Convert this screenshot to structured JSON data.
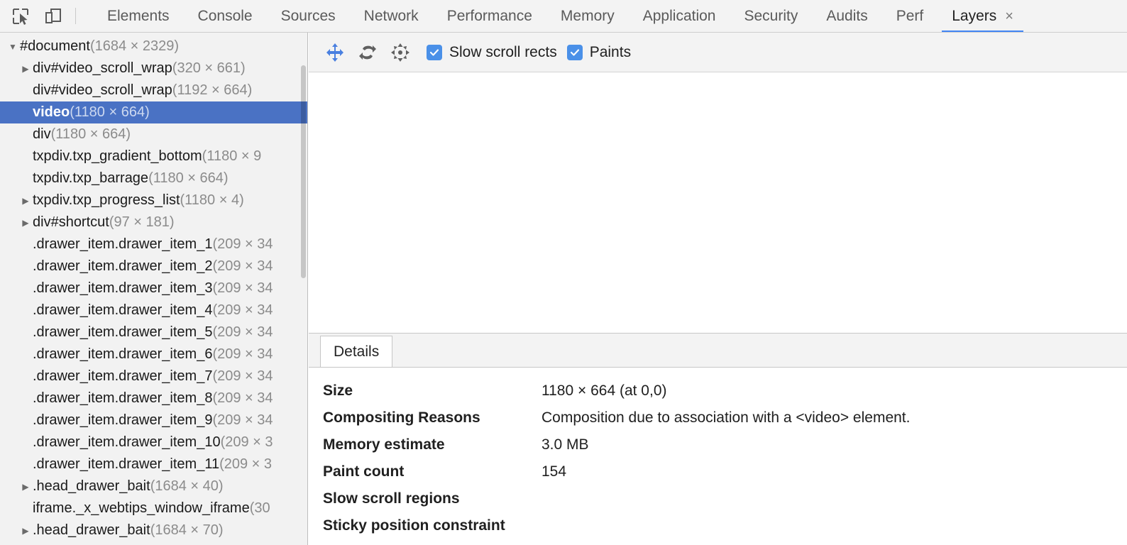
{
  "toolbar_top": {
    "icons": [
      {
        "name": "inspect-element-icon",
        "title": "Inspect element"
      },
      {
        "name": "device-toolbar-icon",
        "title": "Toggle device toolbar"
      }
    ],
    "tabs": [
      {
        "label": "Elements",
        "active": false
      },
      {
        "label": "Console",
        "active": false
      },
      {
        "label": "Sources",
        "active": false
      },
      {
        "label": "Network",
        "active": false
      },
      {
        "label": "Performance",
        "active": false
      },
      {
        "label": "Memory",
        "active": false
      },
      {
        "label": "Application",
        "active": false
      },
      {
        "label": "Security",
        "active": false
      },
      {
        "label": "Audits",
        "active": false
      },
      {
        "label": "Perf",
        "active": false
      },
      {
        "label": "Layers",
        "active": true
      }
    ],
    "close_glyph": "×",
    "active_color": "#4285f4"
  },
  "layer_tree": {
    "nodes": [
      {
        "twisty": "▼",
        "name": "#document",
        "dim": "(1684 × 2329)",
        "indent": 0,
        "selected": false
      },
      {
        "twisty": "▶",
        "name": "div#video_scroll_wrap",
        "dim": "(320 × 661)",
        "indent": 1,
        "selected": false
      },
      {
        "twisty": "",
        "name": "div#video_scroll_wrap",
        "dim": "(1192 × 664)",
        "indent": 1,
        "selected": false
      },
      {
        "twisty": "",
        "name": "video",
        "dim": "(1180 × 664)",
        "indent": 1,
        "selected": true
      },
      {
        "twisty": "",
        "name": "div",
        "dim": "(1180 × 664)",
        "indent": 1,
        "selected": false
      },
      {
        "twisty": "",
        "name": "txpdiv.txp_gradient_bottom",
        "dim": "(1180 × 9",
        "indent": 1,
        "selected": false
      },
      {
        "twisty": "",
        "name": "txpdiv.txp_barrage",
        "dim": "(1180 × 664)",
        "indent": 1,
        "selected": false
      },
      {
        "twisty": "▶",
        "name": "txpdiv.txp_progress_list",
        "dim": "(1180 × 4)",
        "indent": 1,
        "selected": false
      },
      {
        "twisty": "▶",
        "name": "div#shortcut",
        "dim": "(97 × 181)",
        "indent": 1,
        "selected": false
      },
      {
        "twisty": "",
        "name": ".drawer_item.drawer_item_1",
        "dim": "(209 × 34",
        "indent": 1,
        "selected": false
      },
      {
        "twisty": "",
        "name": ".drawer_item.drawer_item_2",
        "dim": "(209 × 34",
        "indent": 1,
        "selected": false
      },
      {
        "twisty": "",
        "name": ".drawer_item.drawer_item_3",
        "dim": "(209 × 34",
        "indent": 1,
        "selected": false
      },
      {
        "twisty": "",
        "name": ".drawer_item.drawer_item_4",
        "dim": "(209 × 34",
        "indent": 1,
        "selected": false
      },
      {
        "twisty": "",
        "name": ".drawer_item.drawer_item_5",
        "dim": "(209 × 34",
        "indent": 1,
        "selected": false
      },
      {
        "twisty": "",
        "name": ".drawer_item.drawer_item_6",
        "dim": "(209 × 34",
        "indent": 1,
        "selected": false
      },
      {
        "twisty": "",
        "name": ".drawer_item.drawer_item_7",
        "dim": "(209 × 34",
        "indent": 1,
        "selected": false
      },
      {
        "twisty": "",
        "name": ".drawer_item.drawer_item_8",
        "dim": "(209 × 34",
        "indent": 1,
        "selected": false
      },
      {
        "twisty": "",
        "name": ".drawer_item.drawer_item_9",
        "dim": "(209 × 34",
        "indent": 1,
        "selected": false
      },
      {
        "twisty": "",
        "name": ".drawer_item.drawer_item_10",
        "dim": "(209 × 3",
        "indent": 1,
        "selected": false
      },
      {
        "twisty": "",
        "name": ".drawer_item.drawer_item_11",
        "dim": "(209 × 3",
        "indent": 1,
        "selected": false
      },
      {
        "twisty": "▶",
        "name": ".head_drawer_bait",
        "dim": "(1684 × 40)",
        "indent": 1,
        "selected": false
      },
      {
        "twisty": "",
        "name": "iframe._x_webtips_window_iframe",
        "dim": "(30",
        "indent": 1,
        "selected": false
      },
      {
        "twisty": "▶",
        "name": ".head_drawer_bait",
        "dim": "(1684 × 70)",
        "indent": 1,
        "selected": false
      }
    ],
    "selected_bg": "#4a72c4"
  },
  "layer_toolbar": {
    "buttons": [
      {
        "name": "pan-mode-button",
        "icon": "pan-arrows-icon",
        "active": true
      },
      {
        "name": "rotate-mode-button",
        "icon": "rotate-arrows-icon",
        "active": false
      },
      {
        "name": "reset-view-button",
        "icon": "center-arrows-icon",
        "active": false
      }
    ],
    "checkboxes": [
      {
        "label": "Slow scroll rects",
        "checked": true
      },
      {
        "label": "Paints",
        "checked": true
      }
    ],
    "checkbox_color": "#4a90e8"
  },
  "details": {
    "tab_label": "Details",
    "rows": [
      {
        "label": "Size",
        "value": "1180 × 664 (at 0,0)"
      },
      {
        "label": "Compositing Reasons",
        "value": "Composition due to association with a <video> element."
      },
      {
        "label": "Memory estimate",
        "value": "3.0 MB"
      },
      {
        "label": "Paint count",
        "value": "154"
      },
      {
        "label": "Slow scroll regions",
        "value": ""
      },
      {
        "label": "Sticky position constraint",
        "value": ""
      }
    ]
  }
}
